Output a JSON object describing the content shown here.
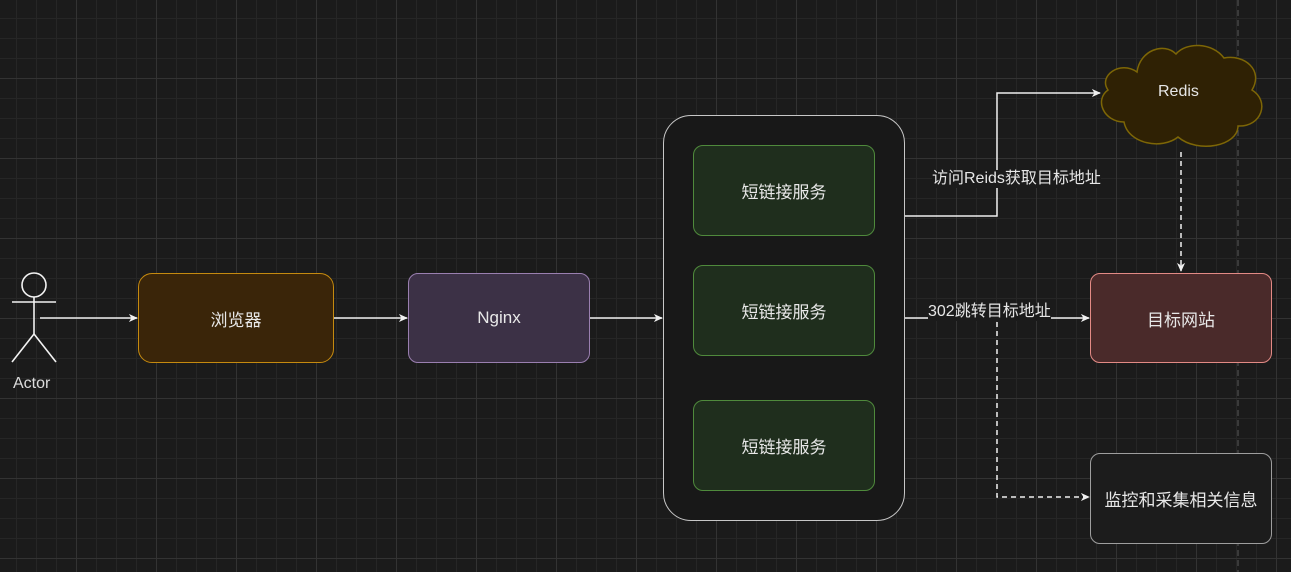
{
  "diagram": {
    "actor_label": "Actor",
    "browser_label": "浏览器",
    "nginx_label": "Nginx",
    "service_labels": [
      "短链接服务",
      "短链接服务",
      "短链接服务"
    ],
    "redis_label": "Redis",
    "target_label": "目标网站",
    "monitor_label": "监控和采集相关信息",
    "edge_redis_label": "访问Reids获取目标地址",
    "edge_redirect_label": "302跳转目标地址"
  },
  "colors": {
    "background": "#1b1b1b",
    "browser_fill": "#3a2509",
    "browser_stroke": "#c58a0f",
    "nginx_fill": "#3c3146",
    "nginx_stroke": "#9a7fb0",
    "service_fill": "#1f2e1d",
    "service_stroke": "#4f8a3c",
    "container_fill": "#181818",
    "container_stroke": "#c7c7c7",
    "redis_fill": "#2f2104",
    "redis_stroke": "#7d6606",
    "target_fill": "#4a2a2a",
    "target_stroke": "#e38a85",
    "monitor_fill": "#1c1c1c",
    "monitor_stroke": "#9e9e9e",
    "edge": "#f0f0f0"
  }
}
